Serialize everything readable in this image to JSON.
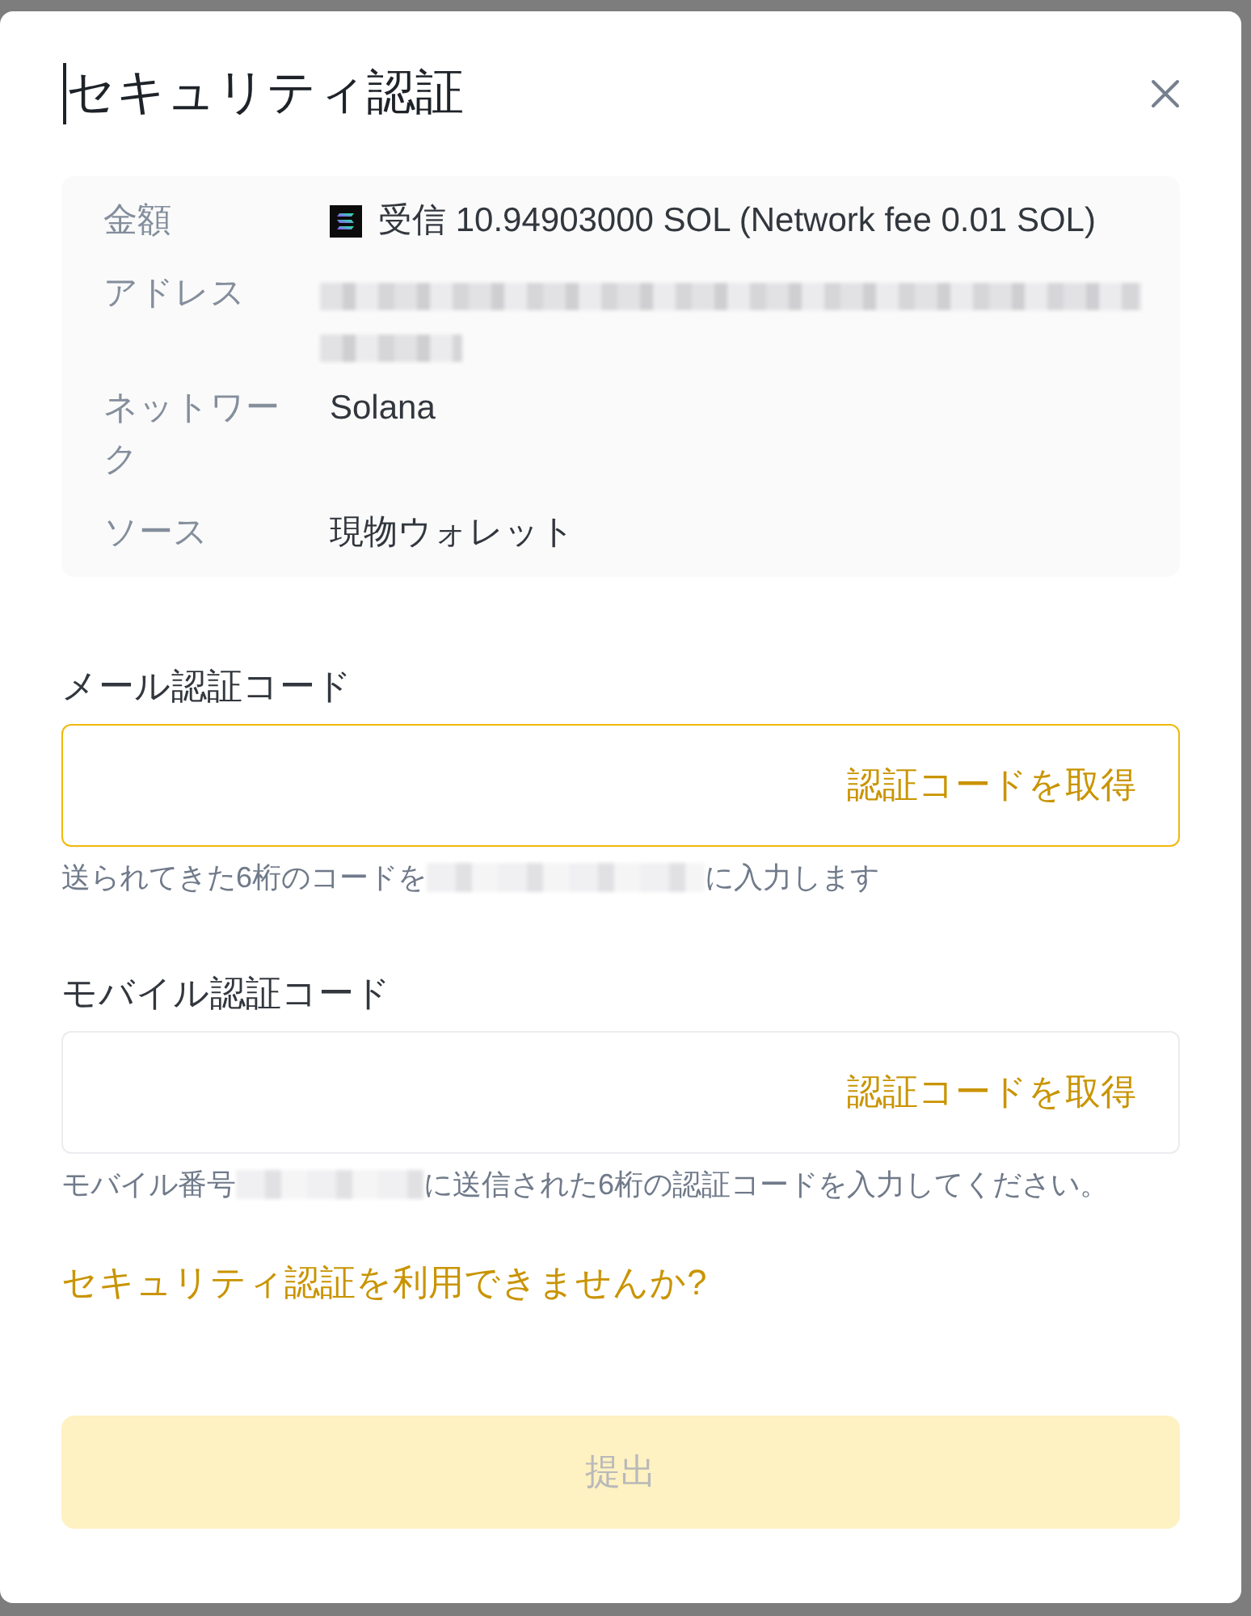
{
  "dialog": {
    "title": "セキュリティ認証"
  },
  "summary": [
    {
      "label": "金額",
      "kind": "amount",
      "value": "受信 10.94903000 SOL (Network fee 0.01 SOL)"
    },
    {
      "label": "アドレス",
      "kind": "redacted"
    },
    {
      "label": "ネットワーク",
      "kind": "text",
      "value": "Solana"
    },
    {
      "label": "ソース",
      "kind": "text",
      "value": "現物ウォレット"
    }
  ],
  "verification_fields": [
    {
      "label": "メール認証コード",
      "focused": true,
      "action": "認証コードを取得",
      "hint_before": "送られてきた6桁のコードを",
      "hint_after": "に入力します"
    },
    {
      "label": "モバイル認証コード",
      "focused": false,
      "action": "認証コードを取得",
      "hint_before": "モバイル番号",
      "hint_after": "に送信された6桁の認証コードを入力してください。"
    }
  ],
  "help_link": "セキュリティ認証を利用できませんか?",
  "submit": {
    "label": "提出",
    "disabled": true
  }
}
